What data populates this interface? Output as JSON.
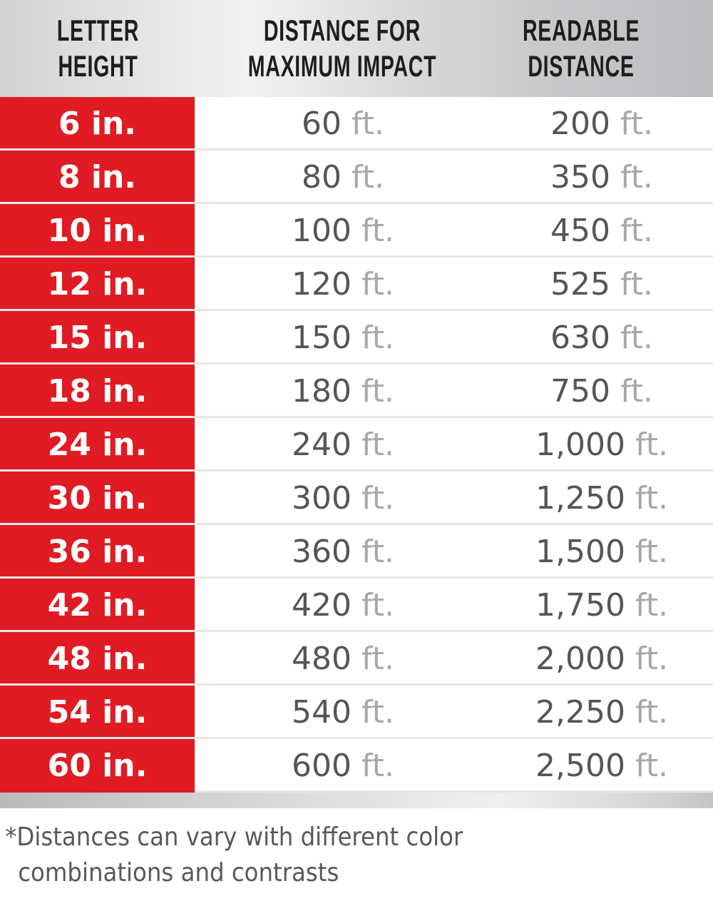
{
  "header": {
    "col1": [
      "LETTER",
      "HEIGHT"
    ],
    "col2": [
      "DISTANCE FOR",
      "MAXIMUM IMPACT"
    ],
    "col3": [
      "READABLE",
      "DISTANCE"
    ]
  },
  "unit_label": "ft.",
  "colors": {
    "accent_red": "#e01b23",
    "value_text": "#555557",
    "unit_text": "#a7a8ab"
  },
  "rows": [
    {
      "height": "6 in.",
      "impact": "60",
      "readable": "200"
    },
    {
      "height": "8 in.",
      "impact": "80",
      "readable": "350"
    },
    {
      "height": "10 in.",
      "impact": "100",
      "readable": "450"
    },
    {
      "height": "12 in.",
      "impact": "120",
      "readable": "525"
    },
    {
      "height": "15 in.",
      "impact": "150",
      "readable": "630"
    },
    {
      "height": "18 in.",
      "impact": "180",
      "readable": "750"
    },
    {
      "height": "24 in.",
      "impact": "240",
      "readable": "1,000"
    },
    {
      "height": "30 in.",
      "impact": "300",
      "readable": "1,250"
    },
    {
      "height": "36 in.",
      "impact": "360",
      "readable": "1,500"
    },
    {
      "height": "42 in.",
      "impact": "420",
      "readable": "1,750"
    },
    {
      "height": "48 in.",
      "impact": "480",
      "readable": "2,000"
    },
    {
      "height": "54 in.",
      "impact": "540",
      "readable": "2,250"
    },
    {
      "height": "60 in.",
      "impact": "600",
      "readable": "2,500"
    }
  ],
  "footnote": [
    "*Distances can vary with different color",
    "combinations and contrasts"
  ]
}
